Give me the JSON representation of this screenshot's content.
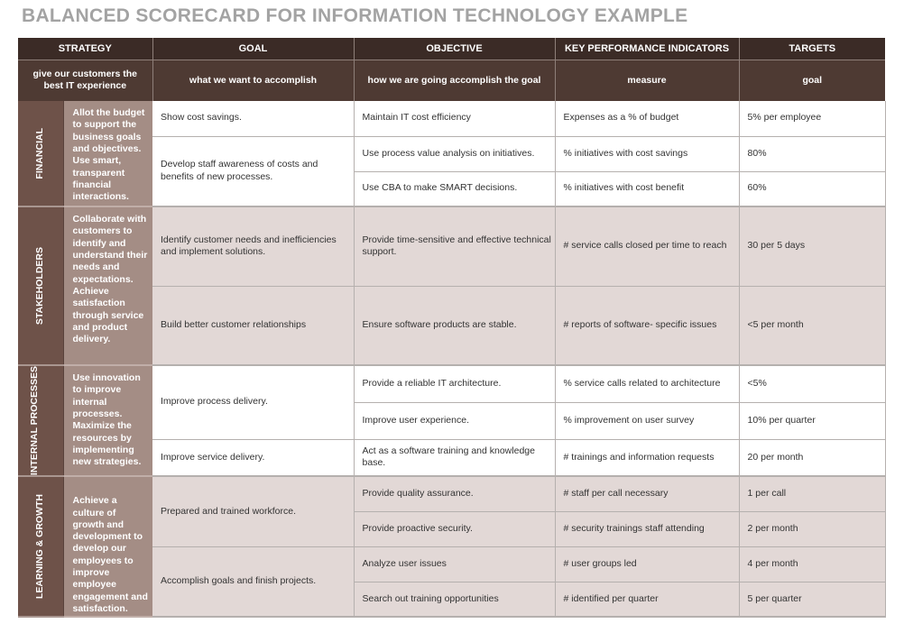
{
  "title": "BALANCED SCORECARD FOR INFORMATION TECHNOLOGY EXAMPLE",
  "colors": {
    "header_bg": "#3b2b26",
    "subheader_bg": "#4e3a33",
    "perspective_bg": "#6e5249",
    "strategy_bg": "#a48d85",
    "row_alt_bg": "#e2d8d6",
    "title_color": "#a3a3a3"
  },
  "headers": {
    "strategy": "STRATEGY",
    "goal": "GOAL",
    "objective": "OBJECTIVE",
    "kpi": "KEY PERFORMANCE INDICATORS",
    "targets": "TARGETS"
  },
  "subheaders": {
    "strategy": "give our customers the best IT experience",
    "goal": "what we want to accomplish",
    "objective": "how we are going accomplish the goal",
    "kpi": "measure",
    "targets": "goal"
  },
  "sections": [
    {
      "perspective": "FINANCIAL",
      "strategy": "Allot the budget to support the business goals and objectives. Use smart, transparent financial interactions.",
      "goals": [
        "Show cost savings.",
        "Develop staff awareness of costs and benefits of new processes."
      ],
      "rows": [
        {
          "objective": "Maintain IT cost efficiency",
          "kpi": "Expenses as a % of budget",
          "target": "5% per employee"
        },
        {
          "objective": "Use process value analysis on initiatives.",
          "kpi": "% initiatives with cost savings",
          "target": "80%"
        },
        {
          "objective": "Use CBA to make SMART decisions.",
          "kpi": "% initiatives with cost benefit",
          "target": "60%"
        }
      ]
    },
    {
      "perspective": "STAKEHOLDERS",
      "strategy": "Collaborate with customers to identify and understand their needs and expectations. Achieve satisfaction through service and product delivery.",
      "goals": [
        "Identify customer needs and inefficiencies and implement solutions.",
        "Build better customer relationships"
      ],
      "rows": [
        {
          "objective": "Provide time-sensitive and  effective technical support.",
          "kpi": "# service calls closed per time to reach",
          "target": "30 per 5 days"
        },
        {
          "objective": "Ensure software products are stable.",
          "kpi": "# reports of software- specific issues",
          "target": "<5 per month"
        }
      ]
    },
    {
      "perspective": "INTERNAL PROCESSES",
      "strategy": "Use innovation to improve internal processes. Maximize the resources by implementing new strategies.",
      "goals": [
        "Improve process delivery.",
        "Improve service delivery."
      ],
      "rows": [
        {
          "objective": "Provide a reliable IT architecture.",
          "kpi": "% service calls related to architecture",
          "target": "<5%"
        },
        {
          "objective": "Improve user experience.",
          "kpi": "% improvement on user survey",
          "target": "10% per quarter"
        },
        {
          "objective": "Act as a software training and knowledge base.",
          "kpi": "# trainings and information requests",
          "target": "20 per month"
        }
      ]
    },
    {
      "perspective": "LEARNING & GROWTH",
      "strategy": "Achieve a culture of growth and development to develop our employees to improve employee engagement and satisfaction.",
      "goals": [
        "Prepared and trained workforce.",
        "Accomplish goals and finish projects."
      ],
      "rows": [
        {
          "objective": "Provide quality assurance.",
          "kpi": "# staff per call necessary",
          "target": "1 per call"
        },
        {
          "objective": "Provide proactive security.",
          "kpi": "# security trainings staff attending",
          "target": "2 per month"
        },
        {
          "objective": "Analyze user issues",
          "kpi": "# user groups led",
          "target": "4 per month"
        },
        {
          "objective": "Search out training opportunities",
          "kpi": "# identified per quarter",
          "target": "5 per quarter"
        }
      ]
    }
  ]
}
